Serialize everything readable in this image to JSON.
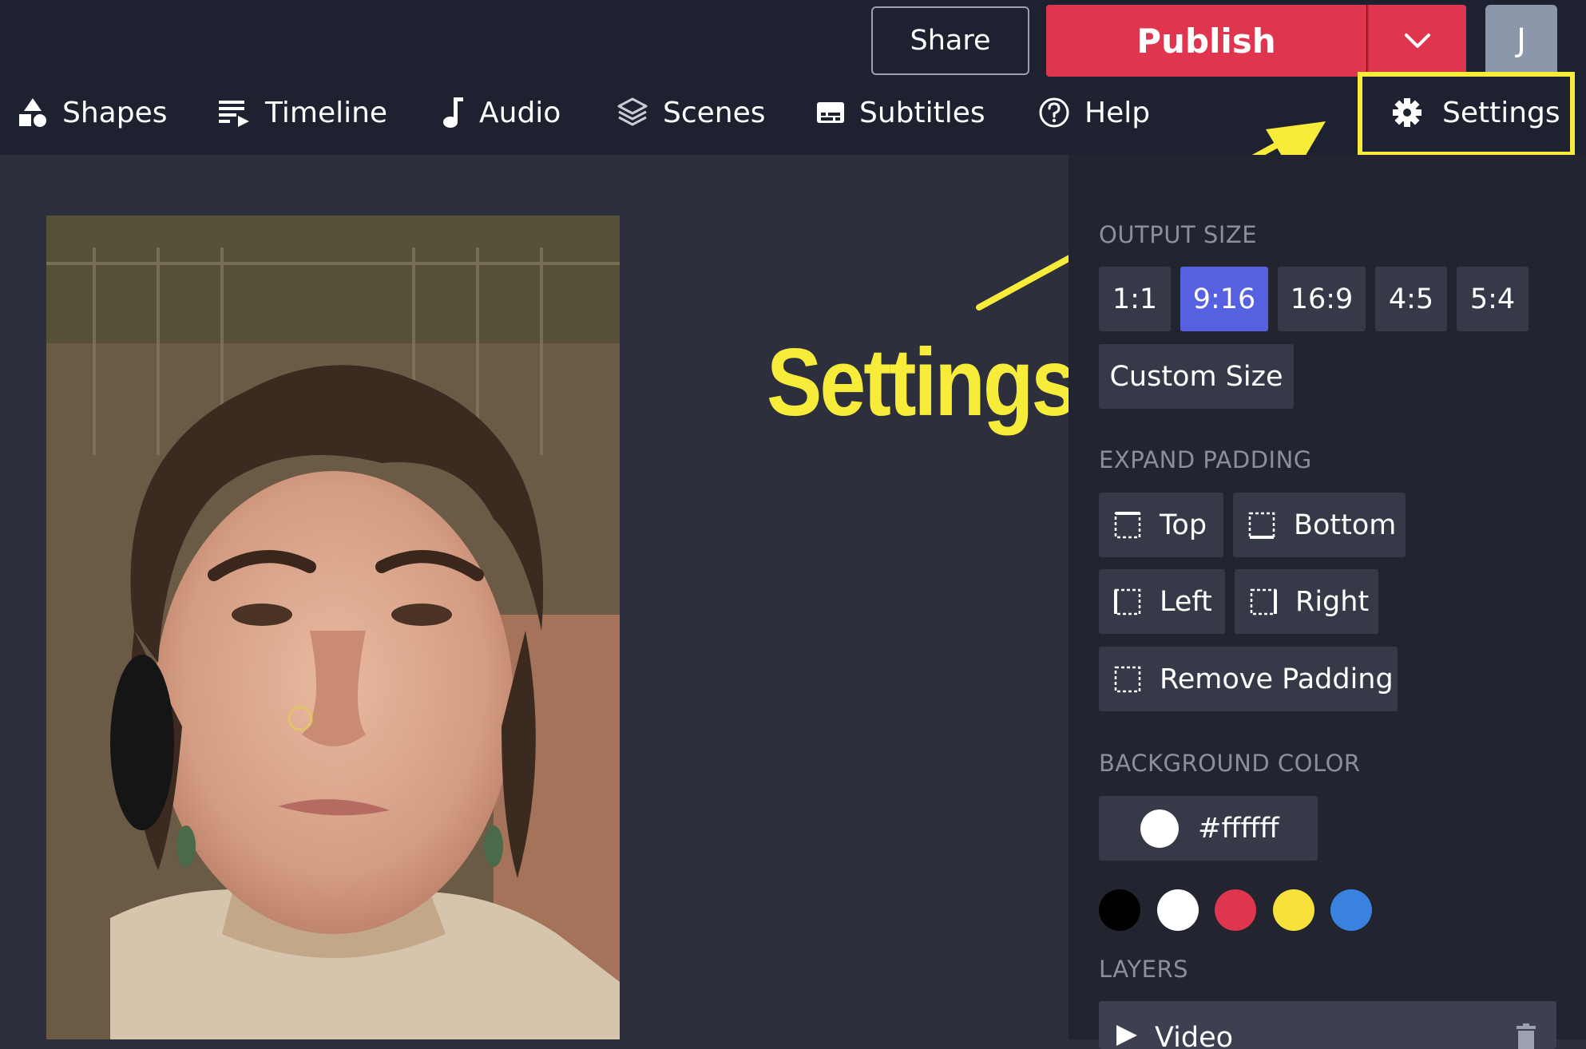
{
  "topbar": {
    "share_label": "Share",
    "publish_label": "Publish",
    "avatar_initial": "J"
  },
  "nav": {
    "items": [
      {
        "label": "Shapes",
        "icon": "shapes-icon"
      },
      {
        "label": "Timeline",
        "icon": "timeline-icon"
      },
      {
        "label": "Audio",
        "icon": "music-note-icon"
      },
      {
        "label": "Scenes",
        "icon": "layers-icon"
      },
      {
        "label": "Subtitles",
        "icon": "subtitles-icon"
      },
      {
        "label": "Help",
        "icon": "help-circle-icon"
      },
      {
        "label": "Settings",
        "icon": "gear-icon"
      }
    ]
  },
  "annotation": {
    "text": "Settings",
    "color": "#f7ec3a"
  },
  "settings": {
    "output_size": {
      "heading": "OUTPUT SIZE",
      "options": [
        "1:1",
        "9:16",
        "16:9",
        "4:5",
        "5:4"
      ],
      "selected": "9:16",
      "custom_label": "Custom Size"
    },
    "expand_padding": {
      "heading": "EXPAND PADDING",
      "top_label": "Top",
      "bottom_label": "Bottom",
      "left_label": "Left",
      "right_label": "Right",
      "remove_label": "Remove Padding"
    },
    "background_color": {
      "heading": "BACKGROUND COLOR",
      "value": "#ffffff",
      "swatches": [
        "#000000",
        "#ffffff",
        "#e0354e",
        "#f7e13a",
        "#3b82e0"
      ]
    },
    "layers": {
      "heading": "LAYERS",
      "items": [
        {
          "label": "Video"
        }
      ]
    }
  },
  "colors": {
    "topbar_bg": "#1d2130",
    "panel_bg": "#22252f",
    "canvas_bg": "#2d2f3d",
    "publish": "#e0354e",
    "active_option": "#5561e0"
  }
}
